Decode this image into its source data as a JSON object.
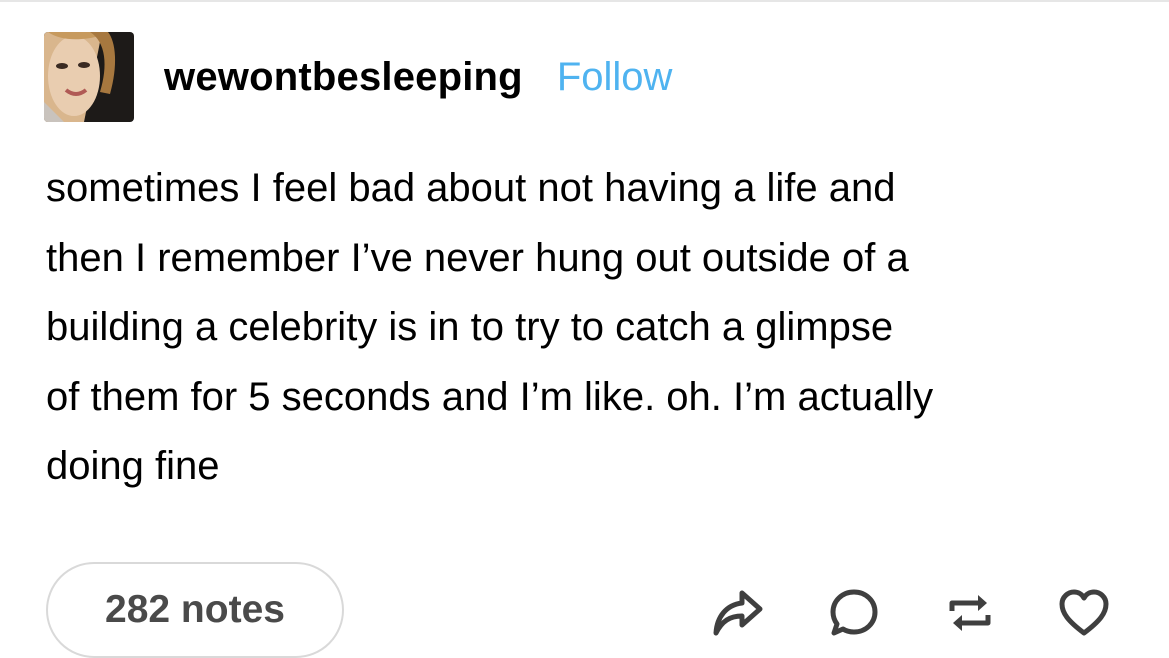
{
  "post": {
    "username": "wewontbesleeping",
    "follow_label": "Follow",
    "avatar_icon": "user-avatar-photo",
    "body_lines": [
      "sometimes I feel bad about not having a life and",
      "then I remember I’ve never hung out outside of a",
      "building a celebrity is in to try to catch a glimpse",
      "of them for 5 seconds and I’m like. oh. I’m actually",
      "doing fine"
    ]
  },
  "footer": {
    "notes_label": "282 notes",
    "actions": [
      {
        "icon": "share-icon"
      },
      {
        "icon": "reply-icon"
      },
      {
        "icon": "reblog-icon"
      },
      {
        "icon": "heart-icon"
      }
    ]
  },
  "colors": {
    "follow": "#4fb3f0",
    "text": "#000000",
    "notes_text": "#4a4a4a",
    "pill_border": "#d9d9d9",
    "icon_stroke": "#3f3f3f"
  }
}
